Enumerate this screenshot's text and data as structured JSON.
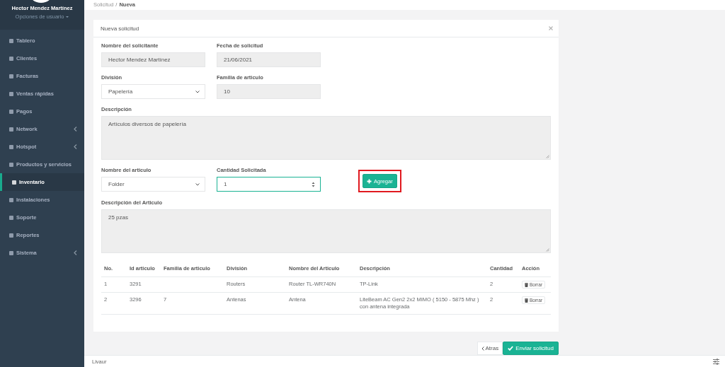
{
  "sidebar": {
    "user": {
      "name": "Hector Mendez Martínez",
      "options": "Opciones de usuario"
    },
    "items": [
      {
        "label": "Tablero",
        "selected": false,
        "has_submenu": false
      },
      {
        "label": "Clientes",
        "selected": false,
        "has_submenu": false
      },
      {
        "label": "Facturas",
        "selected": false,
        "has_submenu": false
      },
      {
        "label": "Ventas rápidas",
        "selected": false,
        "has_submenu": false
      },
      {
        "label": "Pagos",
        "selected": false,
        "has_submenu": false
      },
      {
        "label": "Network",
        "selected": false,
        "has_submenu": true
      },
      {
        "label": "Hotspot",
        "selected": false,
        "has_submenu": true
      },
      {
        "label": "Productos y servicios",
        "selected": false,
        "has_submenu": false
      },
      {
        "label": "Inventario",
        "selected": true,
        "has_submenu": false
      },
      {
        "label": "Instalaciones",
        "selected": false,
        "has_submenu": false
      },
      {
        "label": "Soporte",
        "selected": false,
        "has_submenu": false
      },
      {
        "label": "Reportes",
        "selected": false,
        "has_submenu": false
      },
      {
        "label": "Sistema",
        "selected": false,
        "has_submenu": true
      }
    ]
  },
  "breadcrumb": {
    "parent": "Solicitud",
    "separator": "/",
    "current": "Nueva"
  },
  "panel": {
    "title": "Nueva solicitud",
    "form_rows": [
      [
        {
          "kind": "text",
          "label": "Nombre del solicitante",
          "value": "Hector Mendez Martínez",
          "disabled": true
        },
        {
          "kind": "text",
          "label": "Fecha de solicitud",
          "value": "21/06/2021",
          "disabled": true
        }
      ],
      [
        {
          "kind": "select",
          "label": "División",
          "value": "Papelería",
          "disabled": false
        },
        {
          "kind": "text",
          "label": "Familia de articulo",
          "value": "10",
          "disabled": true
        }
      ],
      [
        {
          "kind": "textarea",
          "label": "Descripción",
          "value": "Artículos diversos de papelería",
          "disabled": true
        }
      ],
      [
        {
          "kind": "select",
          "label": "Nombre del articulo",
          "value": "Folder",
          "disabled": false
        },
        {
          "kind": "number",
          "label": "Cantidad Solicitada",
          "value": "1",
          "disabled": false,
          "focused": true
        },
        {
          "kind": "button",
          "label": "Agregar",
          "highlighted": true
        }
      ],
      [
        {
          "kind": "textarea",
          "label": "Descripción del Articulo",
          "value": "25 pzas",
          "disabled": true
        }
      ]
    ],
    "table": {
      "columns": [
        "No.",
        "Id articulo",
        "Familia de articulo",
        "División",
        "Nombre del Articulo",
        "Descripción",
        "Cantidad",
        "Acción"
      ],
      "rows": [
        {
          "cells": [
            "1",
            "3291",
            "",
            "Routers",
            "Router TL-WR740N",
            "TP-Link",
            "2"
          ],
          "action": "Borrar"
        },
        {
          "cells": [
            "2",
            "3296",
            "7",
            "Antenas",
            "Antena",
            "LiteBeam AC Gen2 2x2 MIMO ( 5150 - 5875 Mhz ) con antena integrada",
            "2"
          ],
          "action": "Borrar"
        }
      ]
    }
  },
  "actions": {
    "back": "Atras",
    "submit": "Enviar solicitud"
  },
  "footer": {
    "text": "Livaur"
  }
}
